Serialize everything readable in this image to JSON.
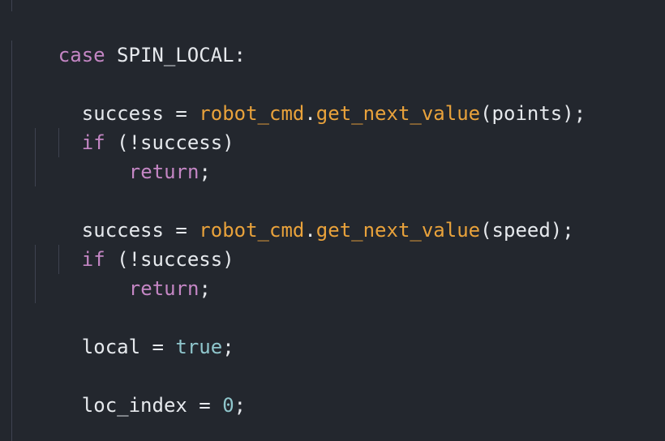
{
  "code": {
    "line1": {
      "kw": "case",
      "rest": " SPIN_LOCAL:"
    },
    "line3": {
      "lhs": "success = ",
      "obj": "robot_cmd",
      "dot": ".",
      "fn": "get_next_value",
      "args": "(points);"
    },
    "line4": {
      "kw": "if",
      "rest": " (!success)"
    },
    "line5": {
      "kw": "return",
      "rest": ";"
    },
    "line7": {
      "lhs": "success = ",
      "obj": "robot_cmd",
      "dot": ".",
      "fn": "get_next_value",
      "args": "(speed);"
    },
    "line8": {
      "kw": "if",
      "rest": " (!success)"
    },
    "line9": {
      "kw": "return",
      "rest": ";"
    },
    "line11": {
      "lhs": "local = ",
      "lit": "true",
      "rest": ";"
    },
    "line13": {
      "lhs": "loc_index = ",
      "lit": "0",
      "rest": ";"
    }
  },
  "colors": {
    "background": "#23272e",
    "keyword": "#c486c4",
    "function": "#e9a23b",
    "literal": "#8fc6cc",
    "text": "#e6e9ed",
    "guide": "#3e4350"
  }
}
